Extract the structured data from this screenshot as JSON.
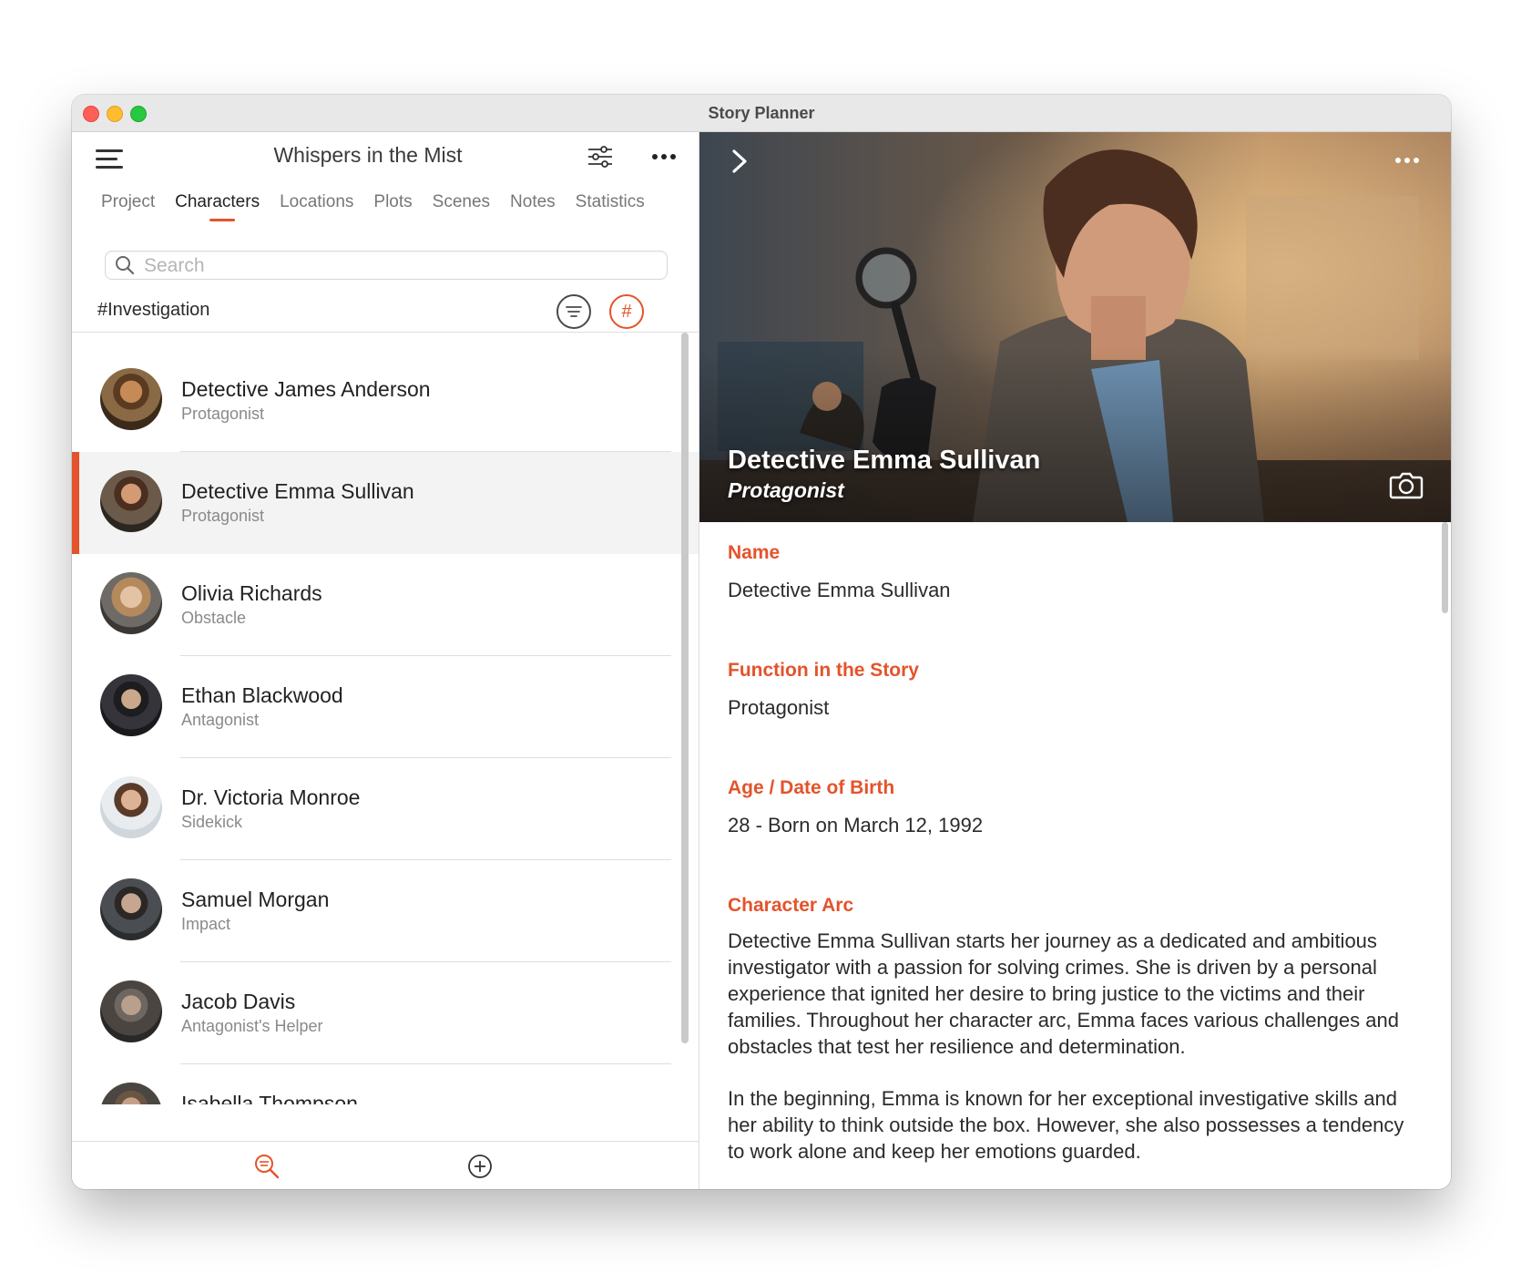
{
  "window": {
    "title": "Story Planner"
  },
  "header": {
    "project_title": "Whispers in the Mist",
    "tabs": [
      "Project",
      "Characters",
      "Locations",
      "Plots",
      "Scenes",
      "Notes",
      "Statistics"
    ],
    "active_tab": "Characters"
  },
  "search": {
    "placeholder": "Search"
  },
  "filter": {
    "tag": "#Investigation",
    "hash_label": "#"
  },
  "characters": [
    {
      "name": "Detective James Anderson",
      "role": "Protagonist"
    },
    {
      "name": "Detective Emma Sullivan",
      "role": "Protagonist",
      "selected": true
    },
    {
      "name": "Olivia Richards",
      "role": "Obstacle"
    },
    {
      "name": "Ethan Blackwood",
      "role": "Antagonist"
    },
    {
      "name": "Dr. Victoria Monroe",
      "role": "Sidekick"
    },
    {
      "name": "Samuel Morgan",
      "role": "Impact"
    },
    {
      "name": "Jacob Davis",
      "role": "Antagonist's Helper"
    },
    {
      "name": "Isabella Thompson",
      "role": ""
    }
  ],
  "detail": {
    "hero_name": "Detective Emma Sullivan",
    "hero_role": "Protagonist",
    "fields": [
      {
        "label": "Name",
        "value": "Detective Emma Sullivan"
      },
      {
        "label": "Function in the Story",
        "value": "Protagonist"
      },
      {
        "label": "Age / Date of Birth",
        "value": "28 - Born on March 12, 1992"
      },
      {
        "label": "Character Arc",
        "paragraphs": [
          "Detective Emma Sullivan starts her journey as a dedicated and ambitious investigator with a passion for solving crimes. She is driven by a personal experience that ignited her desire to bring justice to the victims and their families. Throughout her character arc, Emma faces various challenges and obstacles that test her resilience and determination.",
          "In the beginning, Emma is known for her exceptional investigative skills and her ability to think outside the box. However, she also possesses a tendency to work alone and keep her emotions guarded."
        ]
      }
    ]
  },
  "colors": {
    "accent": "#e4532b",
    "selected_row": "#f3f3f3"
  }
}
